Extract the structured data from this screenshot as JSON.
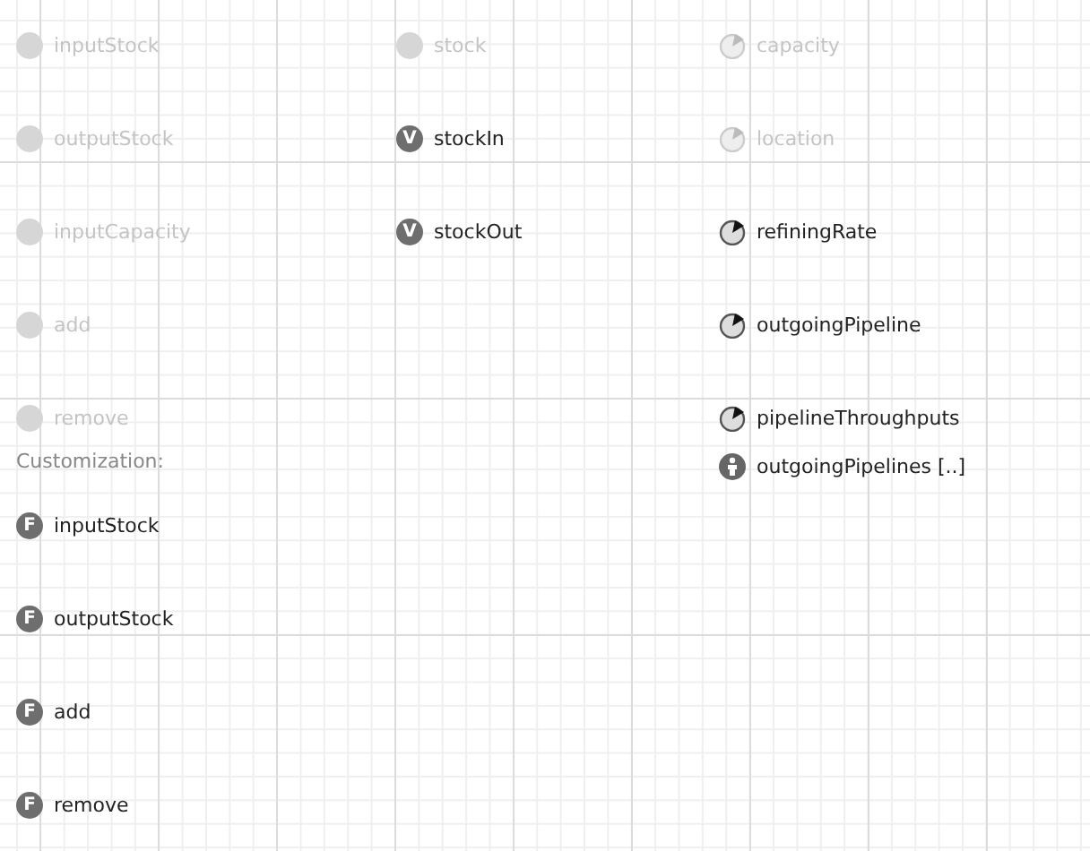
{
  "columns": [
    {
      "items": [
        {
          "kind": "parameter",
          "label": "inputStock",
          "disabled": true
        },
        {
          "kind": "parameter",
          "label": "outputStock",
          "disabled": true
        },
        {
          "kind": "parameter",
          "label": "inputCapacity",
          "disabled": true
        },
        {
          "kind": "parameter",
          "label": "add",
          "disabled": true
        },
        {
          "kind": "parameter",
          "label": "remove",
          "disabled": true
        }
      ]
    },
    {
      "items": [
        {
          "kind": "parameter",
          "label": "stock",
          "disabled": true
        },
        {
          "kind": "variable",
          "badge": "V",
          "label": "stockIn",
          "disabled": false
        },
        {
          "kind": "variable",
          "badge": "V",
          "label": "stockOut",
          "disabled": false
        }
      ]
    },
    {
      "items": [
        {
          "kind": "dynamic",
          "label": "capacity",
          "disabled": true
        },
        {
          "kind": "dynamic",
          "label": "location",
          "disabled": true
        },
        {
          "kind": "dynamic",
          "label": "refiningRate",
          "disabled": false
        },
        {
          "kind": "dynamic",
          "label": "outgoingPipeline",
          "disabled": false
        },
        {
          "kind": "dynamic",
          "label": "pipelineThroughputs",
          "disabled": false
        },
        {
          "kind": "population",
          "label": "outgoingPipelines [..]",
          "disabled": false
        }
      ]
    }
  ],
  "customization": {
    "label": "Customization:",
    "items": [
      {
        "kind": "function",
        "badge": "F",
        "label": "inputStock",
        "disabled": false
      },
      {
        "kind": "function",
        "badge": "F",
        "label": "outputStock",
        "disabled": false
      },
      {
        "kind": "function",
        "badge": "F",
        "label": "add",
        "disabled": false
      },
      {
        "kind": "function",
        "badge": "F",
        "label": "remove",
        "disabled": false
      }
    ]
  }
}
